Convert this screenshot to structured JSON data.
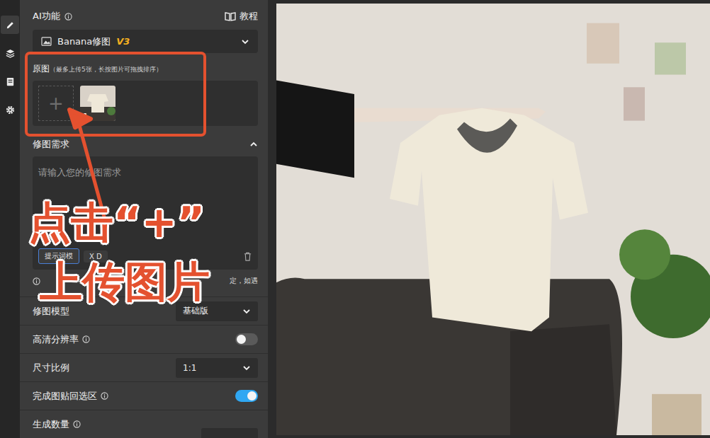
{
  "rail": [
    {
      "kind": "pencil",
      "selected": true
    },
    {
      "kind": "layers",
      "selected": false
    },
    {
      "kind": "document",
      "selected": false
    },
    {
      "kind": "gear",
      "selected": false
    }
  ],
  "ai": {
    "label": "AI功能",
    "tutorial": "教程"
  },
  "feature_select": {
    "value": "Banana修图",
    "badge": "V3"
  },
  "original": {
    "title": "原图",
    "hint": "（最多上传5张，长按图片可拖拽排序）",
    "add": "+",
    "images": [
      {
        "index": "1"
      }
    ]
  },
  "requirement": {
    "title": "修图需求",
    "expanded": true,
    "placeholder": "请输入您的修图需求",
    "chips": [
      "提示词模",
      "X D"
    ],
    "note": "定，如遇"
  },
  "settings": [
    {
      "label": "修图模型",
      "info": false,
      "kind": "select",
      "value": "基础版"
    },
    {
      "label": "高清分辨率",
      "info": true,
      "kind": "toggle",
      "on": false
    },
    {
      "label": "尺寸比例",
      "info": false,
      "kind": "select",
      "value": "1:1"
    },
    {
      "label": "完成图贴回选区",
      "info": true,
      "kind": "toggle",
      "on": true
    },
    {
      "label": "生成数量",
      "info": true,
      "kind": "partial"
    }
  ],
  "annotation": {
    "lines": [
      "点击“+”",
      "上传图片"
    ]
  }
}
